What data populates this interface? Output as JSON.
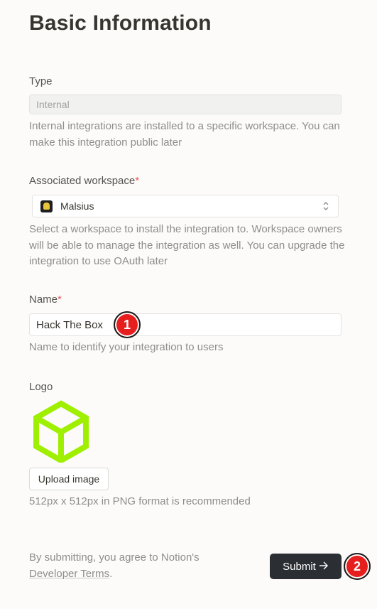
{
  "page_title": "Basic Information",
  "type": {
    "label": "Type",
    "value": "Internal",
    "help": "Internal integrations are installed to a specific workspace. You can make this integration public later"
  },
  "workspace": {
    "label": "Associated workspace",
    "required_mark": "*",
    "selected": "Malsius",
    "help": "Select a workspace to install the integration to. Workspace owners will be able to manage the integration as well. You can upgrade the integration to use OAuth later"
  },
  "name": {
    "label": "Name",
    "required_mark": "*",
    "value": "Hack The Box",
    "help": "Name to identify your integration to users"
  },
  "logo": {
    "label": "Logo",
    "upload_label": "Upload image",
    "help": "512px x 512px in PNG format is recommended",
    "color": "#9fef00"
  },
  "footer": {
    "text": "By submitting, you agree to Notion's",
    "terms_link": "Developer Terms",
    "period": "."
  },
  "submit_label": "Submit",
  "annotations": [
    "1",
    "2"
  ],
  "colors": {
    "accent_badge": "#e61e1e",
    "submit_bg": "#2b2e33",
    "required": "#eb5757"
  }
}
